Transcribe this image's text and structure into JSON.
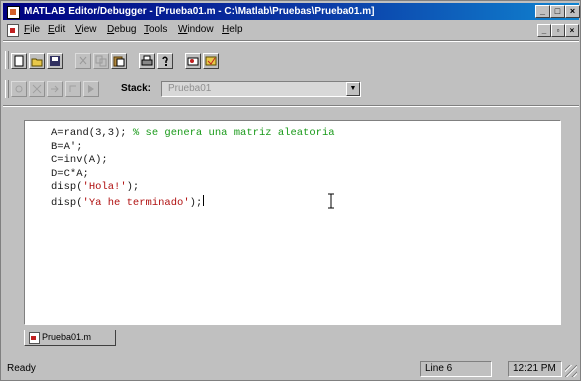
{
  "window": {
    "title": "MATLAB Editor/Debugger - [Prueba01.m - C:\\Matlab\\Pruebas\\Prueba01.m]",
    "min_label": "_",
    "max_label": "□",
    "close_label": "×"
  },
  "menu": {
    "items": [
      {
        "key": "F",
        "rest": "ile"
      },
      {
        "key": "E",
        "rest": "dit"
      },
      {
        "key": "V",
        "rest": "iew"
      },
      {
        "key": "D",
        "rest": "ebug"
      },
      {
        "key": "T",
        "rest": "ools"
      },
      {
        "key": "W",
        "rest": "indow"
      },
      {
        "key": "H",
        "rest": "elp"
      }
    ],
    "child_min": "_",
    "child_max": "▫",
    "child_close": "×"
  },
  "toolbar": {
    "stack_label": "Stack:",
    "stack_value": "Prueba01",
    "dropdown_arrow": "▼"
  },
  "editor": {
    "lines": [
      {
        "code": "A=rand(3,3); ",
        "comment": "% se genera una matriz aleatoria"
      },
      {
        "code": "B=A';"
      },
      {
        "code": "C=inv(A);"
      },
      {
        "code": "D=C*A;"
      },
      {
        "code": "disp(",
        "string": "'Hola!'",
        "tail": ");"
      },
      {
        "code": "disp(",
        "string": "'Ya he terminado'",
        "tail": ");"
      }
    ]
  },
  "tabs": [
    {
      "label": "Prueba01.m"
    }
  ],
  "status": {
    "ready": "Ready",
    "line": "Line 6",
    "time": "12:21 PM"
  }
}
